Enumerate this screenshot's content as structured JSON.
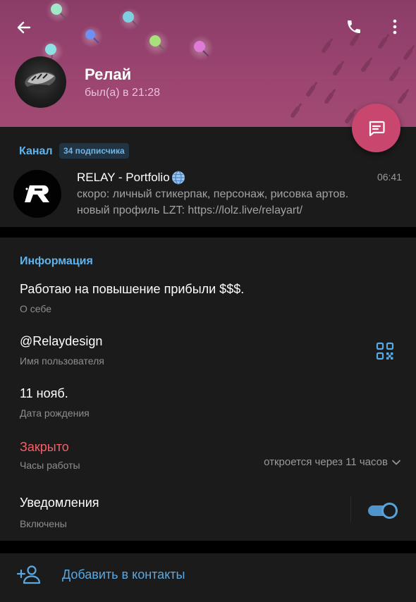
{
  "colors": {
    "header_bg": "#9a4470",
    "fab": "#c9466f",
    "accent_blue": "#61b3ec",
    "closed_red": "#f2616a",
    "section_bg": "#1b1b1b",
    "background": "#000000"
  },
  "header": {
    "back_icon": "arrow-left-icon",
    "call_icon": "phone-icon",
    "more_icon": "more-vertical-icon",
    "name": "Релай",
    "status": "был(а) в 21:28"
  },
  "fab": {
    "icon": "message-icon"
  },
  "channel": {
    "label": "Канал",
    "subscribers": "34 подписчика",
    "name": "RELAY - Portfolio",
    "name_emoji": "globe-icon",
    "time": "06:41",
    "line1": "скоро: личный стикерпак, персонаж, рисовка артов.",
    "line2": "новый профиль LZT: https://lolz.live/relayart/"
  },
  "info": {
    "header": "Информация",
    "bio": {
      "value": "Работаю на повышение прибыли $$$.",
      "label": "О себе"
    },
    "username": {
      "value": "@Relaydesign",
      "label": "Имя пользователя",
      "icon": "qr-code-icon"
    },
    "birthday": {
      "value": "11 нояб.",
      "label": "Дата рождения"
    },
    "hours": {
      "value": "Закрыто",
      "label": "Часы работы",
      "detail": "откроется через 11 часов"
    },
    "notifications": {
      "value": "Уведомления",
      "label": "Включены",
      "enabled": true
    }
  },
  "add_contact": {
    "label": "Добавить в контакты",
    "icon": "add-person-icon"
  }
}
